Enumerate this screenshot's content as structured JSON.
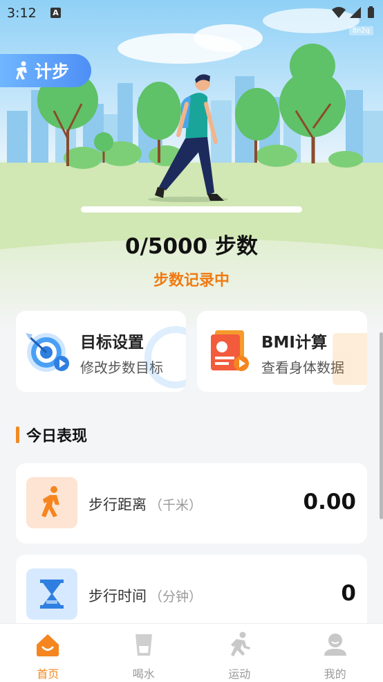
{
  "status_bar": {
    "time": "3:12",
    "notification_glyph": "A",
    "watermark": "8n2q"
  },
  "hero": {
    "badge_label": "计步",
    "steps_current": 0,
    "steps_goal": 5000,
    "steps_text": "0/5000 步数",
    "status_text": "步数记录中",
    "accent_color": "#f08a24"
  },
  "features": [
    {
      "title": "目标设置",
      "subtitle": "修改步数目标",
      "icon": "target-icon"
    },
    {
      "title": "BMI计算",
      "subtitle": "查看身体数据",
      "icon": "bmi-report-icon"
    }
  ],
  "today": {
    "title": "今日表现",
    "stats": [
      {
        "label": "步行距离",
        "unit": "（千米）",
        "value": "0.00",
        "icon": "walking-person-icon"
      },
      {
        "label": "步行时间",
        "unit": "（分钟）",
        "value": "0",
        "icon": "hourglass-icon"
      }
    ]
  },
  "bottom_nav": [
    {
      "label": "首页",
      "icon": "home-icon",
      "active": true
    },
    {
      "label": "喝水",
      "icon": "water-cup-icon",
      "active": false
    },
    {
      "label": "运动",
      "icon": "running-icon",
      "active": false
    },
    {
      "label": "我的",
      "icon": "profile-icon",
      "active": false
    }
  ]
}
